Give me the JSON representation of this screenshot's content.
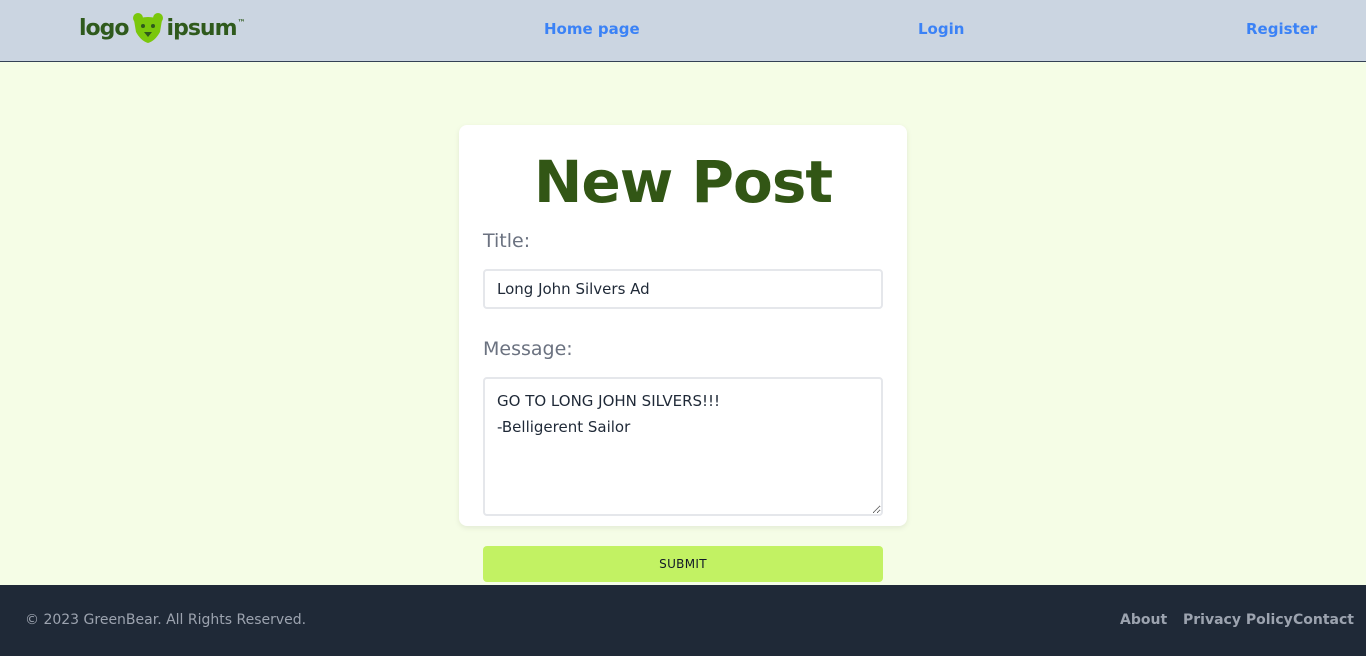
{
  "header": {
    "logo": {
      "left": "logo",
      "right": "ipsum",
      "mark": "bear-icon"
    },
    "nav": {
      "home": "Home page",
      "login": "Login",
      "register": "Register"
    }
  },
  "form": {
    "heading": "New Post",
    "title_label": "Title:",
    "title_value": "Long John Silvers Ad",
    "message_label": "Message:",
    "message_value": "GO TO LONG JOHN SILVERS!!!\n-Belligerent Sailor",
    "submit_label": "SUBMIT"
  },
  "footer": {
    "copyright": "© 2023 GreenBear. All Rights Reserved.",
    "links": {
      "about": "About",
      "privacy": "Privacy Policy",
      "contact": "Contact"
    }
  },
  "colors": {
    "page_bg": "#f5fde6",
    "header_bg": "#cbd5e1",
    "nav_link": "#3b82f6",
    "heading": "#325615",
    "submit_bg": "#c2f263",
    "footer_bg": "#1f2937"
  }
}
